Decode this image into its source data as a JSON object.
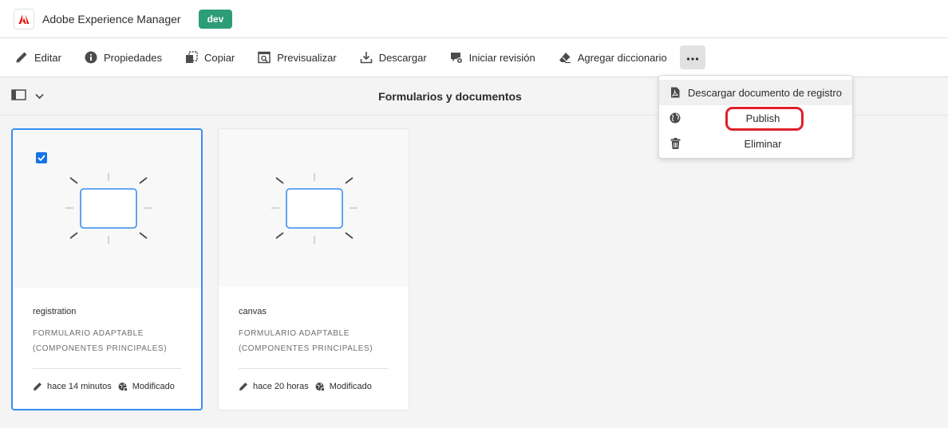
{
  "header": {
    "app_title": "Adobe Experience Manager",
    "env_badge": "dev",
    "brand_color": "#eb1000",
    "badge_color": "#2d9d78"
  },
  "toolbar": {
    "items": [
      {
        "label": "Editar",
        "icon": "pencil-icon"
      },
      {
        "label": "Propiedades",
        "icon": "info-icon"
      },
      {
        "label": "Copiar",
        "icon": "copy-icon"
      },
      {
        "label": "Previsualizar",
        "icon": "preview-icon"
      },
      {
        "label": "Descargar",
        "icon": "download-icon"
      },
      {
        "label": "Iniciar revisión",
        "icon": "review-icon"
      },
      {
        "label": "Agregar diccionario",
        "icon": "eraser-icon"
      }
    ],
    "more_icon": "more-icon"
  },
  "subheader": {
    "title": "Formularios y documentos",
    "rail_icon": "rail-toggle-icon"
  },
  "cards": [
    {
      "name": "registration",
      "type_line1": "FORMULARIO ADAPTABLE",
      "type_line2": "(COMPONENTES PRINCIPALES)",
      "modified_time": "hace 14 minutos",
      "status": "Modificado",
      "selected": true
    },
    {
      "name": "canvas",
      "type_line1": "FORMULARIO ADAPTABLE",
      "type_line2": "(COMPONENTES PRINCIPALES)",
      "modified_time": "hace 20 horas",
      "status": "Modificado",
      "selected": false
    }
  ],
  "menu": {
    "items": [
      {
        "label": "Descargar documento de registro",
        "icon": "pdf-icon"
      },
      {
        "label": "Publish",
        "icon": "globe-icon"
      },
      {
        "label": "Eliminar",
        "icon": "trash-icon"
      }
    ],
    "highlight_color": "#e0202a"
  }
}
